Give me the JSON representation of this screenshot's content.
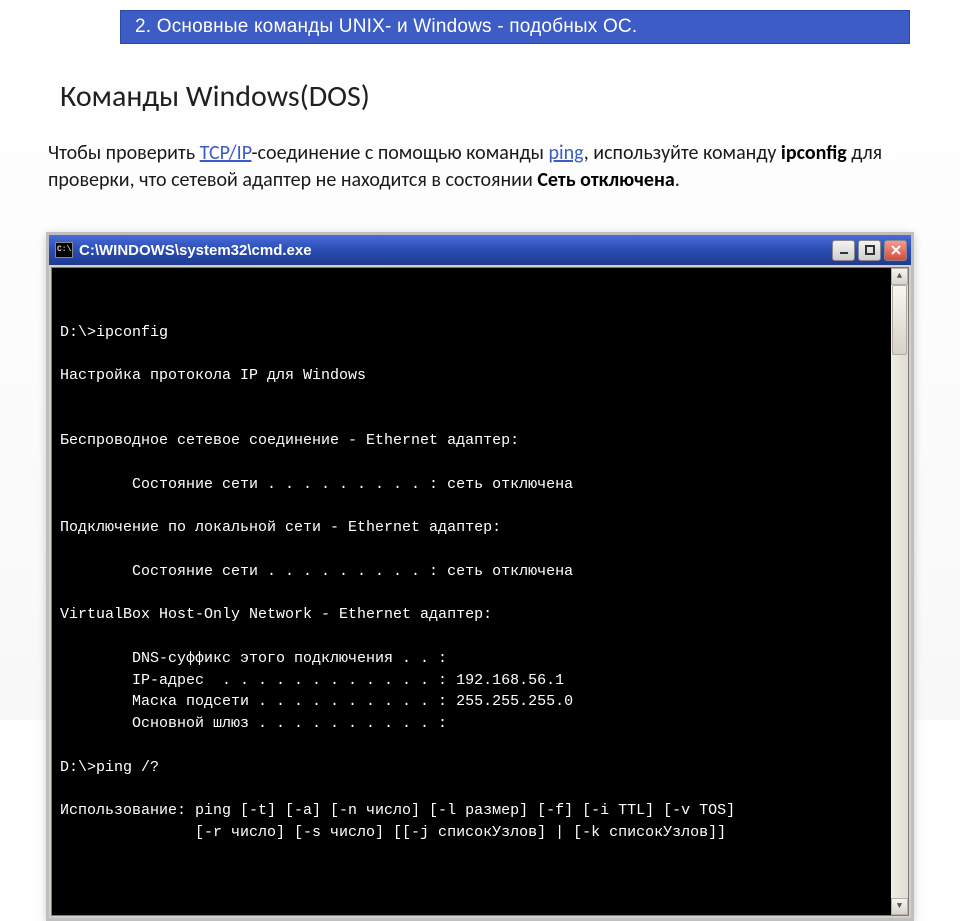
{
  "header": {
    "title": "2. Основные команды UNIX- и Windows - подобных ОС."
  },
  "heading": "Команды Windows(DOS)",
  "paragraph": {
    "p1": "Чтобы проверить ",
    "link_tcpip": "TCP/IP",
    "p2": "-соединение с помощью команды ",
    "link_ping": "ping",
    "p3": ", используйте команду ",
    "bold_ipconfig": "ipconfig",
    "p4": " для проверки, что сетевой адаптер не находится в состоянии ",
    "bold_net": "Сеть отключена",
    "p5": "."
  },
  "cmd": {
    "title": "C:\\WINDOWS\\system32\\cmd.exe",
    "icon_text": "C:\\",
    "lines": [
      "D:\\>ipconfig",
      "",
      "Настройка протокола IP для Windows",
      "",
      "",
      "Беспроводное сетевое соединение - Ethernet адаптер:",
      "",
      "        Состояние сети . . . . . . . . . : сеть отключена",
      "",
      "Подключение по локальной сети - Ethernet адаптер:",
      "",
      "        Состояние сети . . . . . . . . . : сеть отключена",
      "",
      "VirtualBox Host-Only Network - Ethernet адаптер:",
      "",
      "        DNS-суффикс этого подключения . . :",
      "        IP-адрес  . . . . . . . . . . . . : 192.168.56.1",
      "        Маска подсети . . . . . . . . . . : 255.255.255.0",
      "        Основной шлюз . . . . . . . . . . :",
      "",
      "D:\\>ping /?",
      "",
      "Использование: ping [-t] [-a] [-n число] [-l размер] [-f] [-i TTL] [-v TOS]",
      "               [-r число] [-s число] [[-j списокУзлов] | [-k списокУзлов]]"
    ]
  }
}
